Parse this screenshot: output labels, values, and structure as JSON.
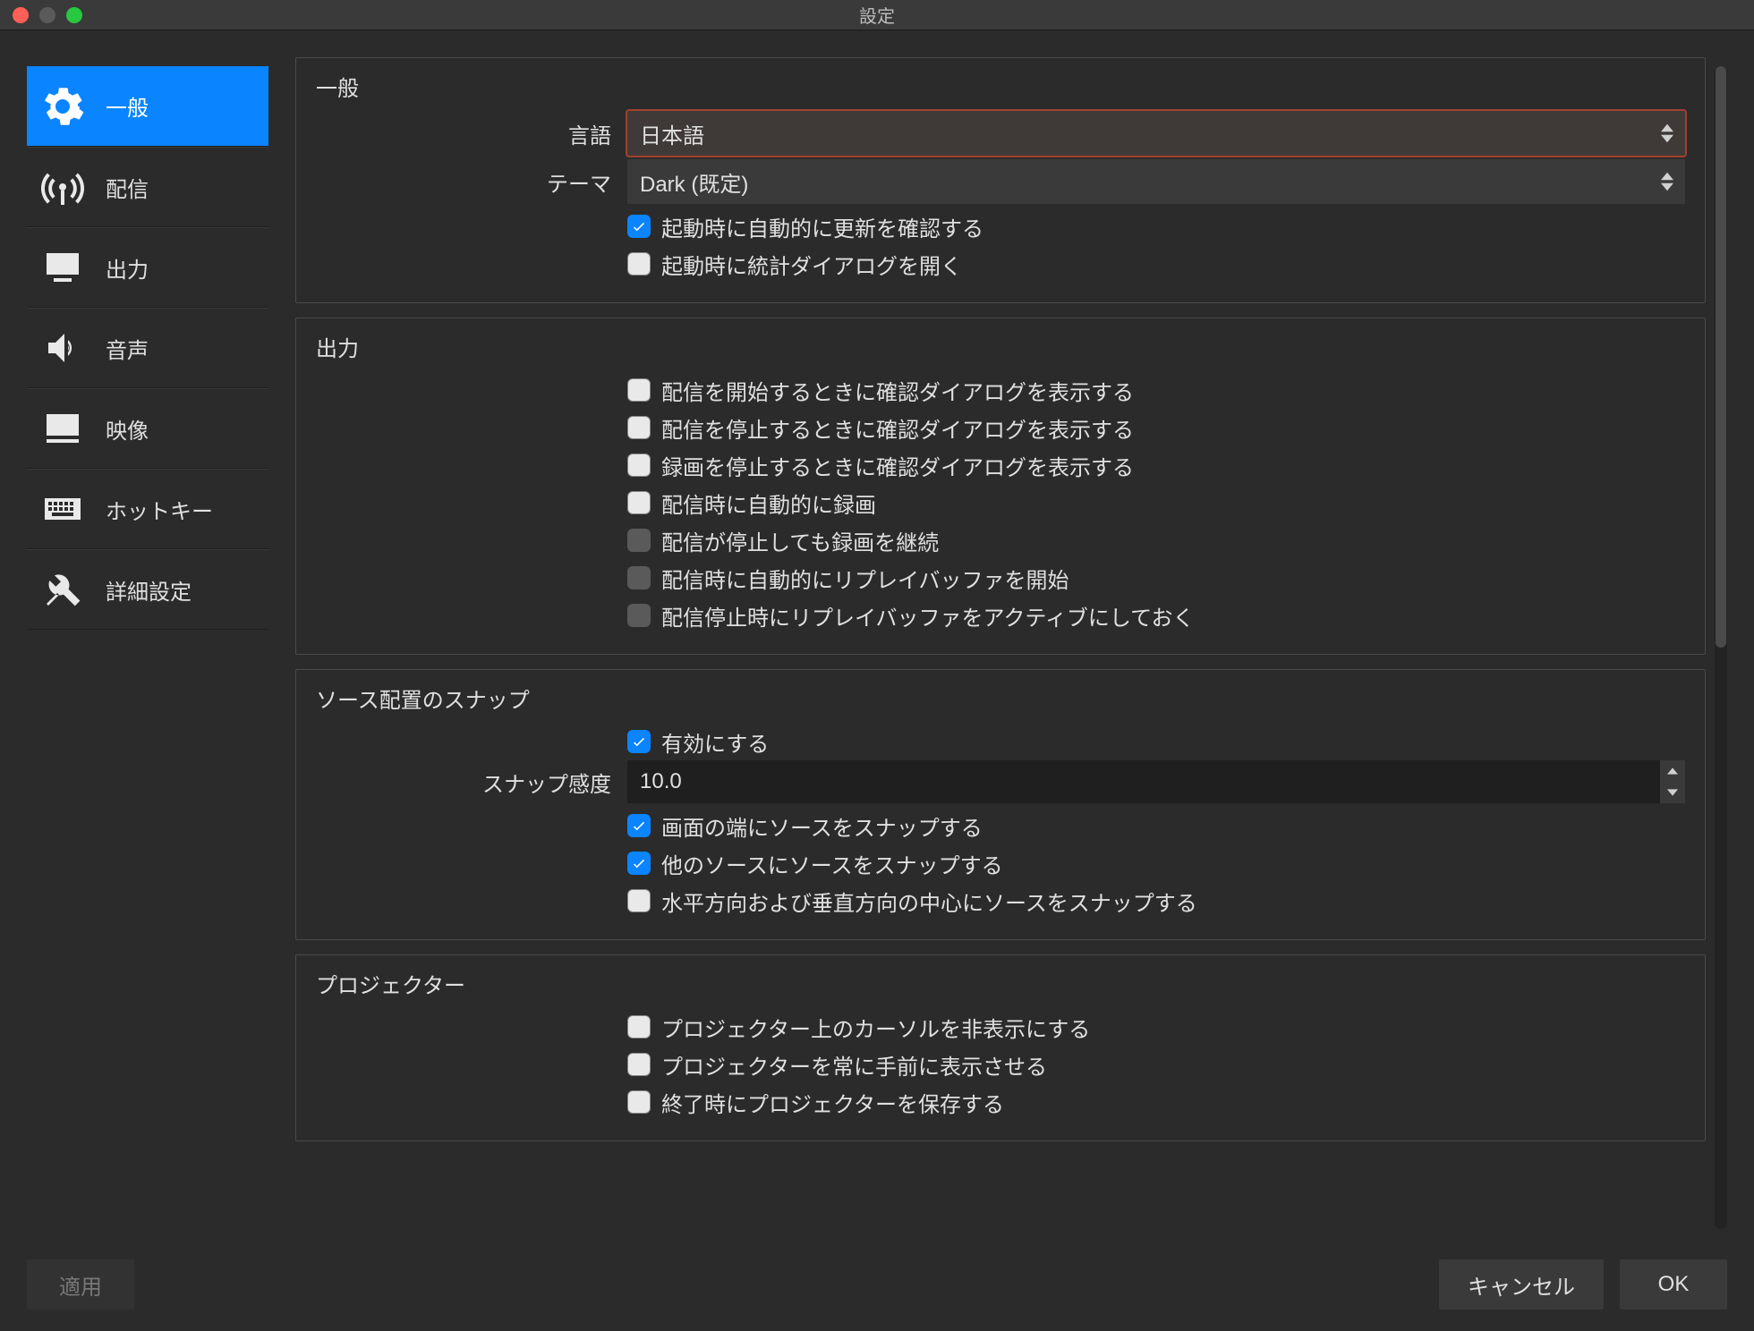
{
  "window": {
    "title": "設定"
  },
  "sidebar": {
    "items": [
      {
        "label": "一般"
      },
      {
        "label": "配信"
      },
      {
        "label": "出力"
      },
      {
        "label": "音声"
      },
      {
        "label": "映像"
      },
      {
        "label": "ホットキー"
      },
      {
        "label": "詳細設定"
      }
    ]
  },
  "sections": {
    "general": {
      "title": "一般",
      "language_label": "言語",
      "language_value": "日本語",
      "theme_label": "テーマ",
      "theme_value": "Dark (既定)",
      "check_update": "起動時に自動的に更新を確認する",
      "open_stats": "起動時に統計ダイアログを開く"
    },
    "output": {
      "title": "出力",
      "confirm_stream_start": "配信を開始するときに確認ダイアログを表示する",
      "confirm_stream_stop": "配信を停止するときに確認ダイアログを表示する",
      "confirm_record_stop": "録画を停止するときに確認ダイアログを表示する",
      "auto_record": "配信時に自動的に録画",
      "keep_record": "配信が停止しても録画を継続",
      "auto_replay": "配信時に自動的にリプレイバッファを開始",
      "keep_replay": "配信停止時にリプレイバッファをアクティブにしておく"
    },
    "snap": {
      "title": "ソース配置のスナップ",
      "enable": "有効にする",
      "sensitivity_label": "スナップ感度",
      "sensitivity_value": "10.0",
      "snap_edge": "画面の端にソースをスナップする",
      "snap_other": "他のソースにソースをスナップする",
      "snap_center": "水平方向および垂直方向の中心にソースをスナップする"
    },
    "projector": {
      "title": "プロジェクター",
      "hide_cursor": "プロジェクター上のカーソルを非表示にする",
      "always_top": "プロジェクターを常に手前に表示させる",
      "save_on_exit": "終了時にプロジェクターを保存する"
    }
  },
  "buttons": {
    "apply": "適用",
    "cancel": "キャンセル",
    "ok": "OK"
  }
}
